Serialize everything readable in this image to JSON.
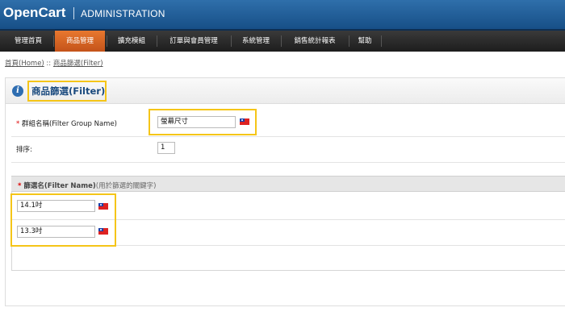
{
  "header": {
    "logo": "OpenCart",
    "subtitle": "ADMINISTRATION"
  },
  "menu": [
    {
      "label": "管理首頁",
      "active": false
    },
    {
      "label": "商品管理",
      "active": true
    },
    {
      "label": "擴充模組",
      "active": false
    },
    {
      "label": "訂單與會員管理",
      "active": false
    },
    {
      "label": "系統管理",
      "active": false
    },
    {
      "label": "銷售統計報表",
      "active": false
    },
    {
      "label": "幫助",
      "active": false
    }
  ],
  "breadcrumb": {
    "home": "首頁(Home)",
    "sep": " :: ",
    "current": "商品篩選(Filter)"
  },
  "box": {
    "title": "商品篩選(Filter)"
  },
  "form": {
    "group_name": {
      "required": "* ",
      "label": "群組名稱(Filter Group Name)",
      "value": "螢幕尺寸"
    },
    "sort_order": {
      "label": "排序:",
      "value": "1"
    }
  },
  "filters": {
    "required": "* ",
    "header": "篩選名(Filter Name)",
    "hint": "(用於篩選的關鍵字)",
    "rows": [
      {
        "value": "14.1吋"
      },
      {
        "value": "13.3吋"
      }
    ]
  },
  "colors": {
    "header_bg": "#174f87",
    "menu_active": "#c4531a",
    "highlight": "#f5c518",
    "title": "#1a4a7e"
  },
  "icons": {
    "info": "info-icon",
    "flag": "taiwan-flag-icon"
  }
}
